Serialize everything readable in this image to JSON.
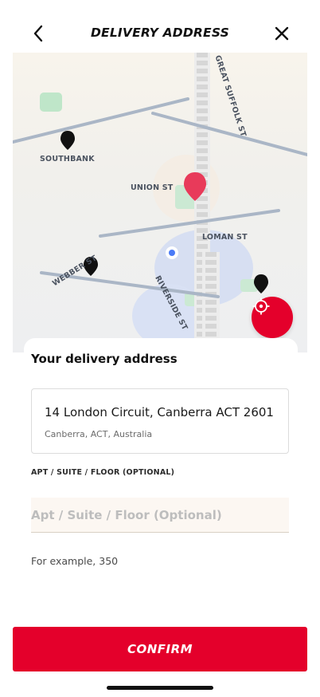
{
  "header": {
    "title": "DELIVERY ADDRESS",
    "back_icon": "chevron-left-icon",
    "close_icon": "close-icon"
  },
  "map": {
    "labels": {
      "southbank": "SOUTHBANK",
      "union_st": "UNION ST",
      "loman_st": "LOMAN ST",
      "webber_st": "WEBBER ST",
      "riverside_st": "RIVERSIDE ST",
      "great_suffolk_st": "GREAT SUFFOLK ST"
    },
    "accent_color": "#e4002b",
    "locate_icon": "crosshair-icon"
  },
  "delivery": {
    "section_title": "Your delivery address",
    "address_line1": "14 London Circuit, Canberra ACT 2601",
    "address_line2": "Canberra, ACT, Australia"
  },
  "apt": {
    "label": "APT / SUITE / FLOOR (OPTIONAL)",
    "placeholder": "Apt / Suite / Floor (Optional)",
    "value": "",
    "hint": "For example, 350"
  },
  "footer": {
    "confirm_label": "CONFIRM"
  }
}
